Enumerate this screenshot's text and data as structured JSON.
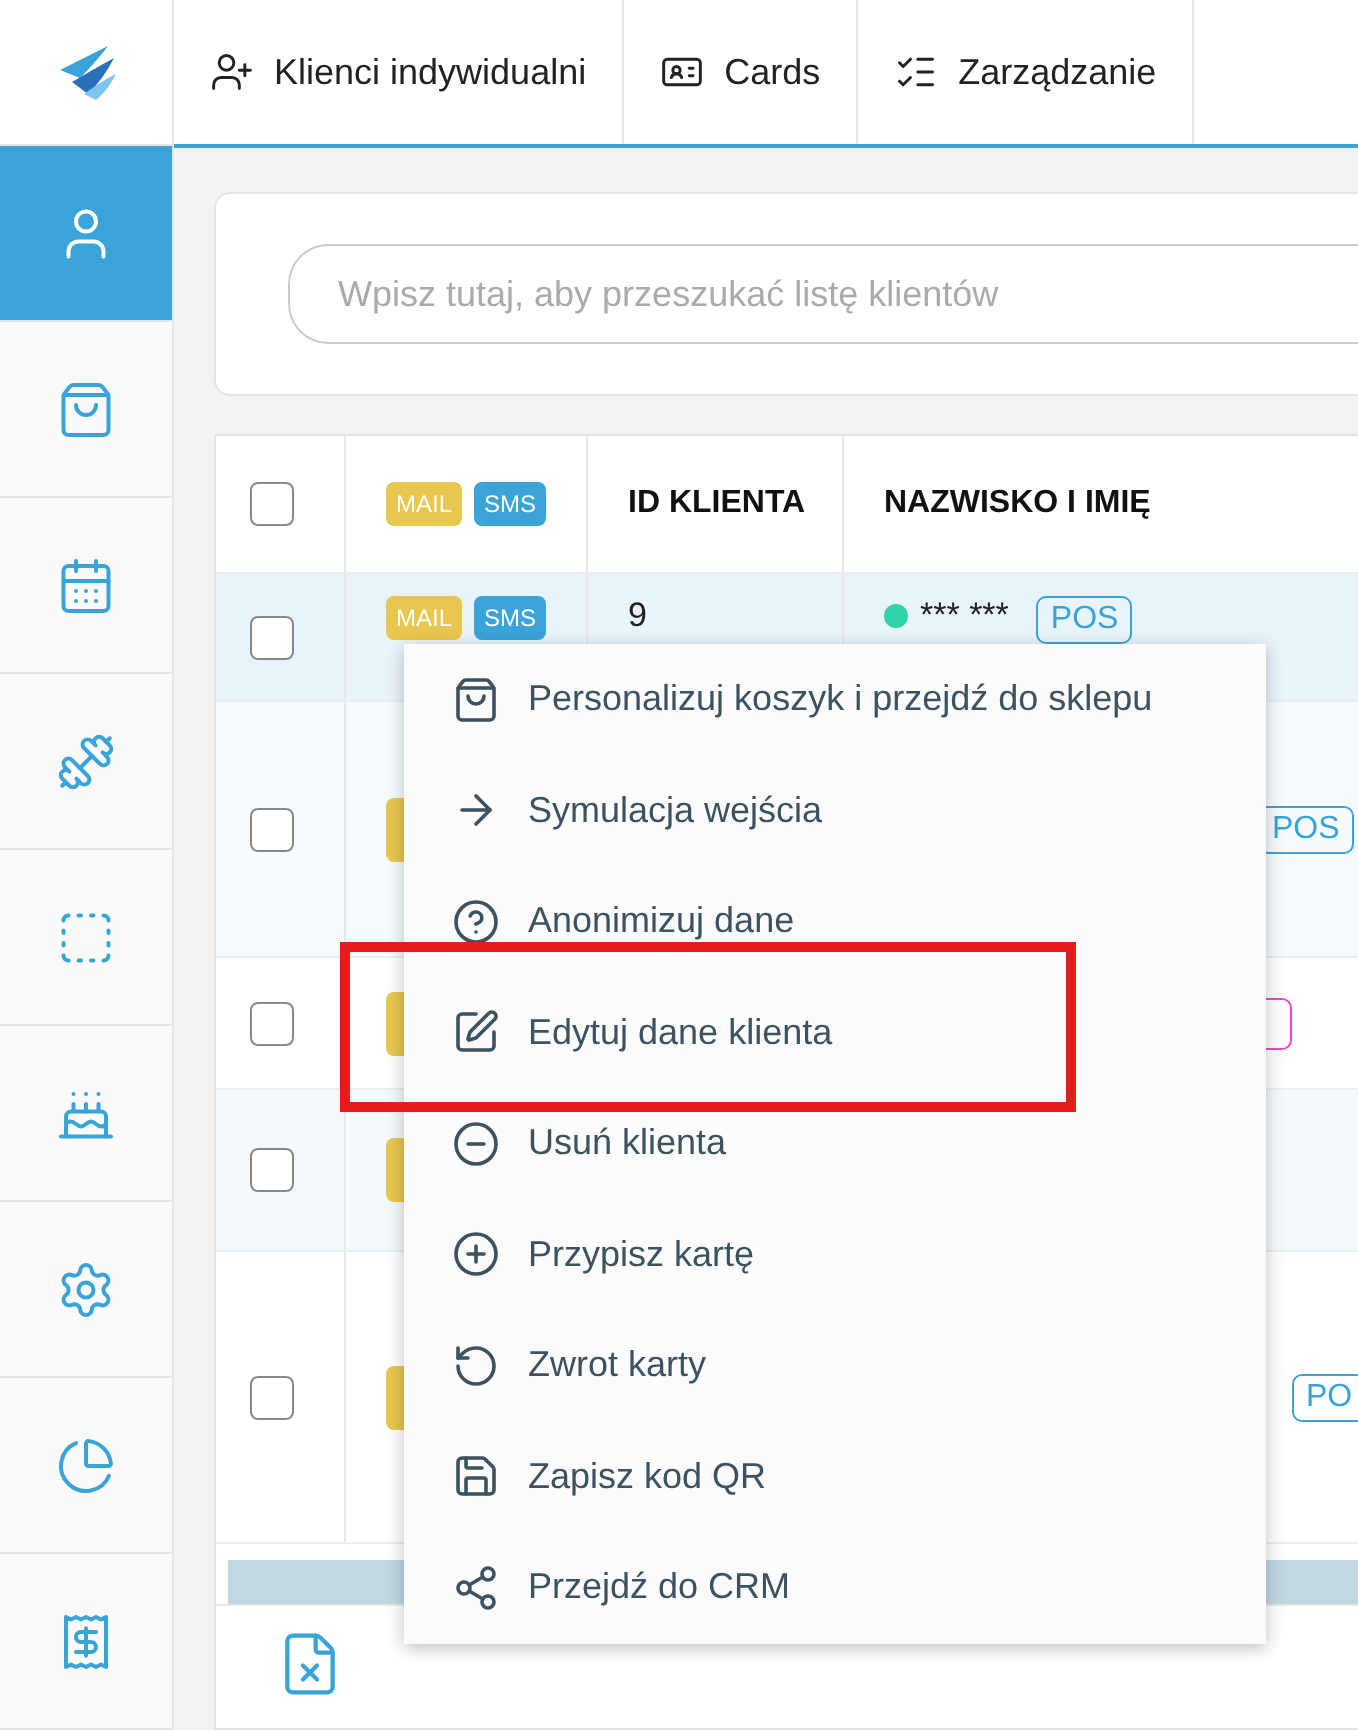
{
  "tabs": [
    {
      "label": "Klienci indywidualni"
    },
    {
      "label": "Cards"
    },
    {
      "label": "Zarządzanie"
    }
  ],
  "sidebar": {
    "items": [
      {
        "selected": true
      },
      {
        "selected": false
      },
      {
        "selected": false
      },
      {
        "selected": false
      },
      {
        "selected": false
      },
      {
        "selected": false
      },
      {
        "selected": false
      },
      {
        "selected": false
      },
      {
        "selected": false
      }
    ]
  },
  "search": {
    "placeholder": "Wpisz tutaj, aby przeszukać listę klientów"
  },
  "table": {
    "header": {
      "checked": false,
      "badges": [
        {
          "label": "MAIL",
          "color": "#e8c64f"
        },
        {
          "label": "SMS",
          "color": "#3aa3d8"
        }
      ],
      "columns": [
        "ID KLIENTA",
        "NAZWISKO I IMIĘ"
      ]
    },
    "rows": [
      {
        "checked": false,
        "badges": [
          {
            "label": "MAIL",
            "color": "#e8c64f"
          },
          {
            "label": "SMS",
            "color": "#3aa3d8"
          }
        ],
        "id": "9",
        "status_dot": {
          "color": "#2fd3a8"
        },
        "name": "*** ***",
        "tag": {
          "label": "POS",
          "color": "#3aa3d8"
        }
      },
      {
        "checked": false,
        "badges": [
          {
            "color": "#e8c64f"
          }
        ],
        "tag": {
          "label": "POS",
          "color": "#3aa3d8"
        }
      },
      {
        "checked": false,
        "badges": [
          {
            "color": "#e8c64f"
          }
        ],
        "tag": {
          "color": "#f048c0"
        }
      },
      {
        "checked": false,
        "badges": [
          {
            "color": "#e8c64f"
          }
        ]
      },
      {
        "checked": false,
        "badges": [
          {
            "color": "#e8c64f"
          }
        ],
        "tag": {
          "label": "PO",
          "color": "#3aa3d8"
        }
      }
    ]
  },
  "context_menu": {
    "items": [
      {
        "label": "Personalizuj koszyk i przejdź do sklepu",
        "highlighted": false
      },
      {
        "label": "Symulacja wejścia",
        "highlighted": false
      },
      {
        "label": "Anonimizuj dane",
        "highlighted": false
      },
      {
        "label": "Edytuj dane klienta",
        "highlighted": true
      },
      {
        "label": "Usuń klienta",
        "highlighted": false
      },
      {
        "label": "Przypisz kartę",
        "highlighted": false
      },
      {
        "label": "Zwrot karty",
        "highlighted": false
      },
      {
        "label": "Zapisz kod QR",
        "highlighted": false
      },
      {
        "label": "Przejdź do CRM",
        "highlighted": false
      }
    ]
  }
}
